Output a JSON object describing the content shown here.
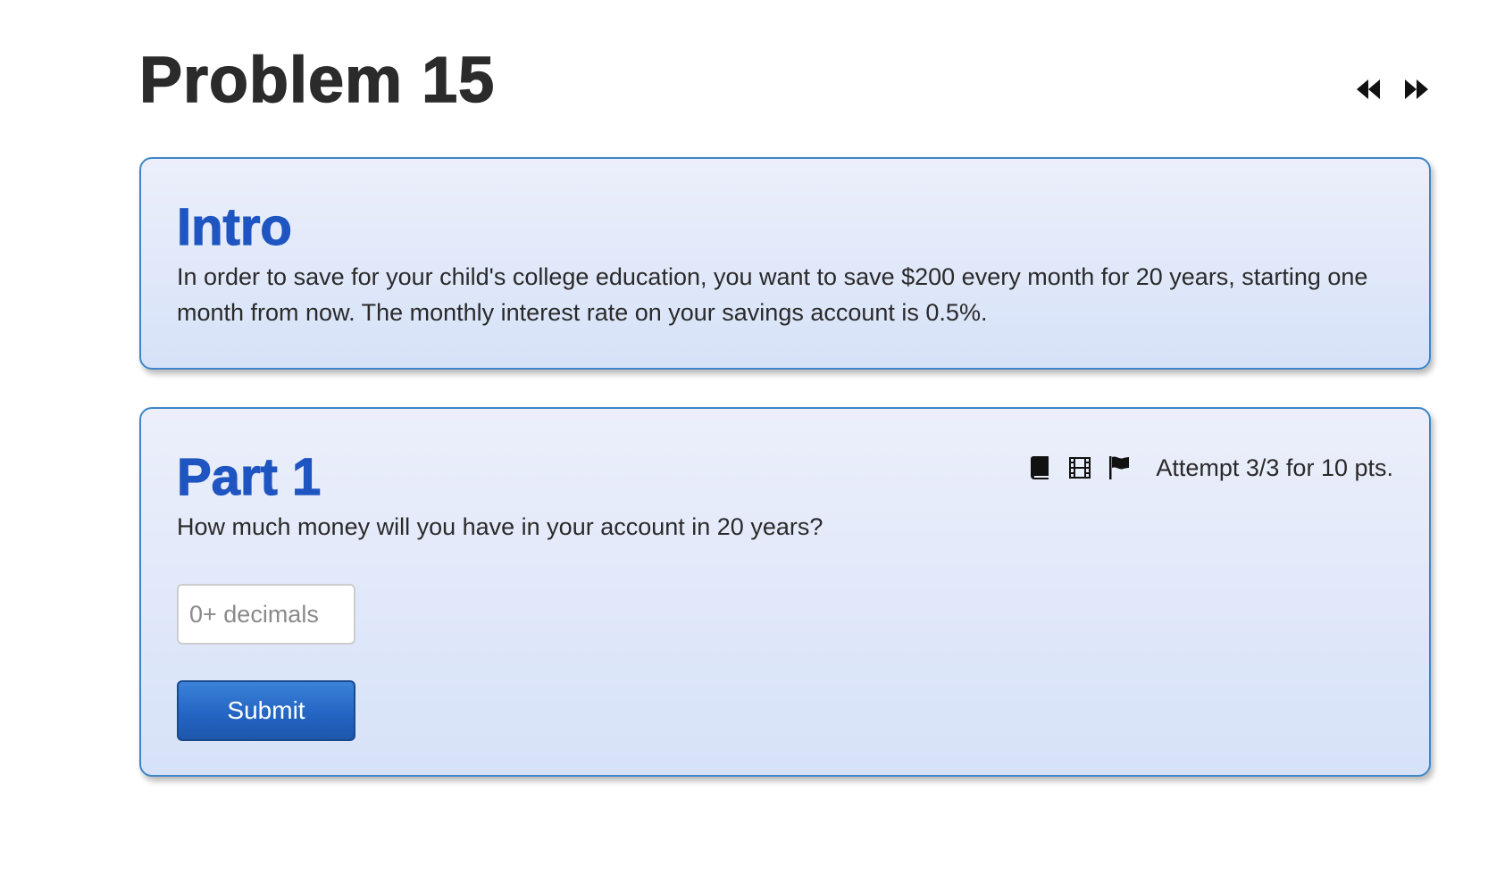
{
  "page": {
    "title": "Problem 15"
  },
  "nav": {
    "prev_icon": "rewind-icon",
    "next_icon": "fast-forward-icon"
  },
  "intro": {
    "title": "Intro",
    "text": "In order to save for your child's college education, you want to save $200 every month for 20 years, starting one month from now. The monthly interest rate on your savings account is 0.5%."
  },
  "part1": {
    "title": "Part 1",
    "question": "How much money will you have in your account in 20 years?",
    "attempt": "Attempt 3/3 for 10 pts.",
    "icons": [
      "book-icon",
      "film-icon",
      "flag-icon"
    ],
    "input": {
      "value": "",
      "placeholder": "0+ decimals"
    },
    "submit_label": "Submit"
  },
  "colors": {
    "heading_blue": "#1f55c1",
    "card_border": "#3f86c8",
    "button_blue": "#2466c4",
    "title_dark": "#2b2b2b"
  }
}
